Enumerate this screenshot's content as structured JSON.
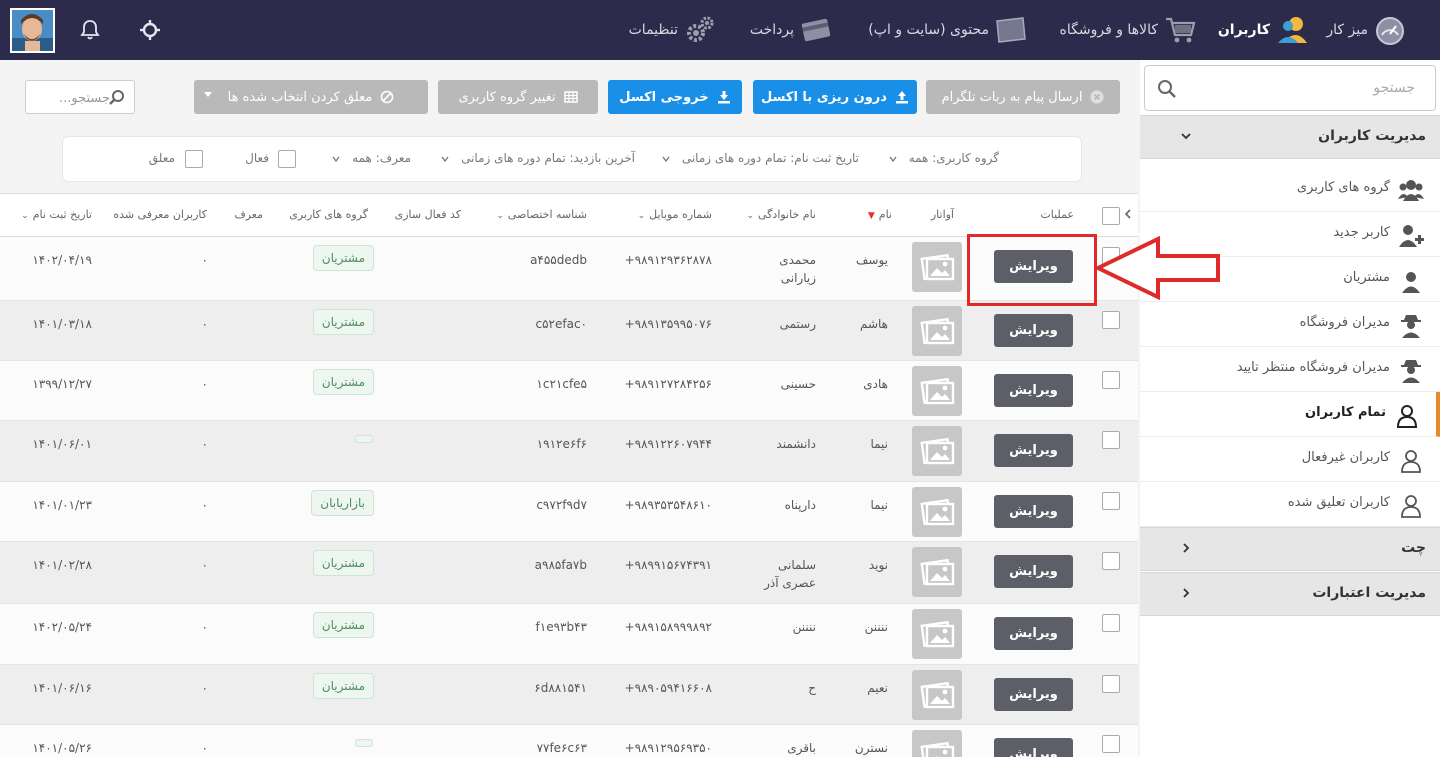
{
  "topbar": {
    "nav": [
      {
        "label": "میز کار",
        "icon": "dashboard-icon",
        "active": false
      },
      {
        "label": "کاربران",
        "icon": "users-icon",
        "active": true
      },
      {
        "label": "کالاها و فروشگاه",
        "icon": "cart-icon",
        "active": false
      },
      {
        "label": "محتوی (سایت و اپ)",
        "icon": "monitor-icon",
        "active": false
      },
      {
        "label": "پرداخت",
        "icon": "credit-card-icon",
        "active": false
      },
      {
        "label": "تنظیمات",
        "icon": "gears-icon",
        "active": false
      }
    ]
  },
  "sidebar": {
    "search_placeholder": "جستجو",
    "sections": [
      {
        "label": "مدیریت کاربران",
        "expanded": true
      },
      {
        "label": "چت",
        "expanded": false
      },
      {
        "label": "مدیریت اعتبارات",
        "expanded": false
      }
    ],
    "items": [
      {
        "label": "گروه های کاربری",
        "icon": "user-group-icon"
      },
      {
        "label": "کاربر جدید",
        "icon": "user-plus-icon"
      },
      {
        "label": "مشتریان",
        "icon": "user-icon"
      },
      {
        "label": "مدیران فروشگاه",
        "icon": "user-secret-icon"
      },
      {
        "label": "مدیران فروشگاه منتظر تایید",
        "icon": "user-secret-icon"
      },
      {
        "label": "تمام کاربران",
        "icon": "user-outline-icon",
        "active": true
      },
      {
        "label": "کاربران غیرفعال",
        "icon": "user-outline-icon"
      },
      {
        "label": "کاربران تعلیق شده",
        "icon": "user-outline-icon"
      }
    ]
  },
  "toolbar": {
    "telegram": "ارسال پیام به ربات تلگرام",
    "import_excel": "درون ریزی با اکسل",
    "export_excel": "خروجی اکسل",
    "change_group": "تغییر گروه کاربری",
    "suspend_selected": "معلق کردن انتخاب شده ها",
    "search_placeholder": "جستجو..."
  },
  "filters": {
    "user_group": "گروه کاربری:  همه",
    "register_date": "تاریخ ثبت نام: تمام دوره های زمانی",
    "last_visit": "آخرین بازدید: تمام دوره های زمانی",
    "referrer": "معرف:  همه",
    "active": "فعال",
    "suspended": "معلق"
  },
  "table": {
    "headers": {
      "operations": "عملیات",
      "avatar": "آواتار",
      "first_name": "نام",
      "last_name": "نام خانوادگی",
      "mobile": "شماره موبایل",
      "private_id": "شناسه اختصاصی",
      "activation_code": "کد فعال سازی",
      "user_groups": "گروه های کاربری",
      "referrer": "معرف",
      "referred_users": "کاربران معرفی شده",
      "register_date": "تاریخ ثبت نام"
    },
    "edit_label": "ویرایش",
    "rows": [
      {
        "first": "یوسف",
        "last": "محمدی زیارانی",
        "mobile": "+۹۸۹۱۲۹۳۶۲۸۷۸",
        "pid": "a۴۵۵dedb",
        "group": "مشتریان",
        "ref_count": "۰",
        "date": "۱۴۰۲/۰۴/۱۹"
      },
      {
        "first": "هاشم",
        "last": "رستمی",
        "mobile": "+۹۸۹۱۳۵۹۹۵۰۷۶",
        "pid": "c۵۲efac۰",
        "group": "مشتریان",
        "ref_count": "۰",
        "date": "۱۴۰۱/۰۳/۱۸"
      },
      {
        "first": "هادی",
        "last": "حسینی",
        "mobile": "+۹۸۹۱۲۷۲۸۴۲۵۶",
        "pid": "۱c۲۱cfe۵",
        "group": "مشتریان",
        "ref_count": "۰",
        "date": "۱۳۹۹/۱۲/۲۷"
      },
      {
        "first": "نیما",
        "last": "دانشمند",
        "mobile": "+۹۸۹۱۲۲۶۰۷۹۴۴",
        "pid": "۱۹۱۲e۶f۶",
        "group": "",
        "ref_count": "۰",
        "date": "۱۴۰۱/۰۶/۰۱"
      },
      {
        "first": "نیما",
        "last": "دارپناه",
        "mobile": "+۹۸۹۳۵۳۵۴۸۶۱۰",
        "pid": "c۹۷۲f۹d۷",
        "group": "بازاریابان",
        "ref_count": "۰",
        "date": "۱۴۰۱/۰۱/۲۳"
      },
      {
        "first": "نوید",
        "last": "سلمانی عصری آذر",
        "mobile": "+۹۸۹۹۱۵۶۷۴۳۹۱",
        "pid": "a۹۸۵fa۷b",
        "group": "مشتریان",
        "ref_count": "۰",
        "date": "۱۴۰۱/۰۲/۲۸"
      },
      {
        "first": "ننننن",
        "last": "ننننن",
        "mobile": "+۹۸۹۱۵۸۹۹۹۸۹۲",
        "pid": "f۱e۹۳b۴۳",
        "group": "مشتریان",
        "ref_count": "۰",
        "date": "۱۴۰۲/۰۵/۲۴"
      },
      {
        "first": "نعیم",
        "last": "ح",
        "mobile": "+۹۸۹۰۵۹۴۱۶۶۰۸",
        "pid": "۶d۸۸۱۵۴۱",
        "group": "مشتریان",
        "ref_count": "۰",
        "date": "۱۴۰۱/۰۶/۱۶"
      },
      {
        "first": "نسترن",
        "last": "باقری",
        "mobile": "+۹۸۹۱۲۹۵۶۹۳۵۰",
        "pid": "۷۷fe۶c۶۳",
        "group": "",
        "ref_count": "۰",
        "date": "۱۴۰۱/۰۵/۲۶"
      }
    ]
  },
  "colors": {
    "topbar": "#2c2b4b",
    "accent_blue": "#1a8fe8",
    "edit_button": "#5c5e68",
    "annotation_red": "#e02a2a",
    "active_marker": "#e8892a"
  }
}
